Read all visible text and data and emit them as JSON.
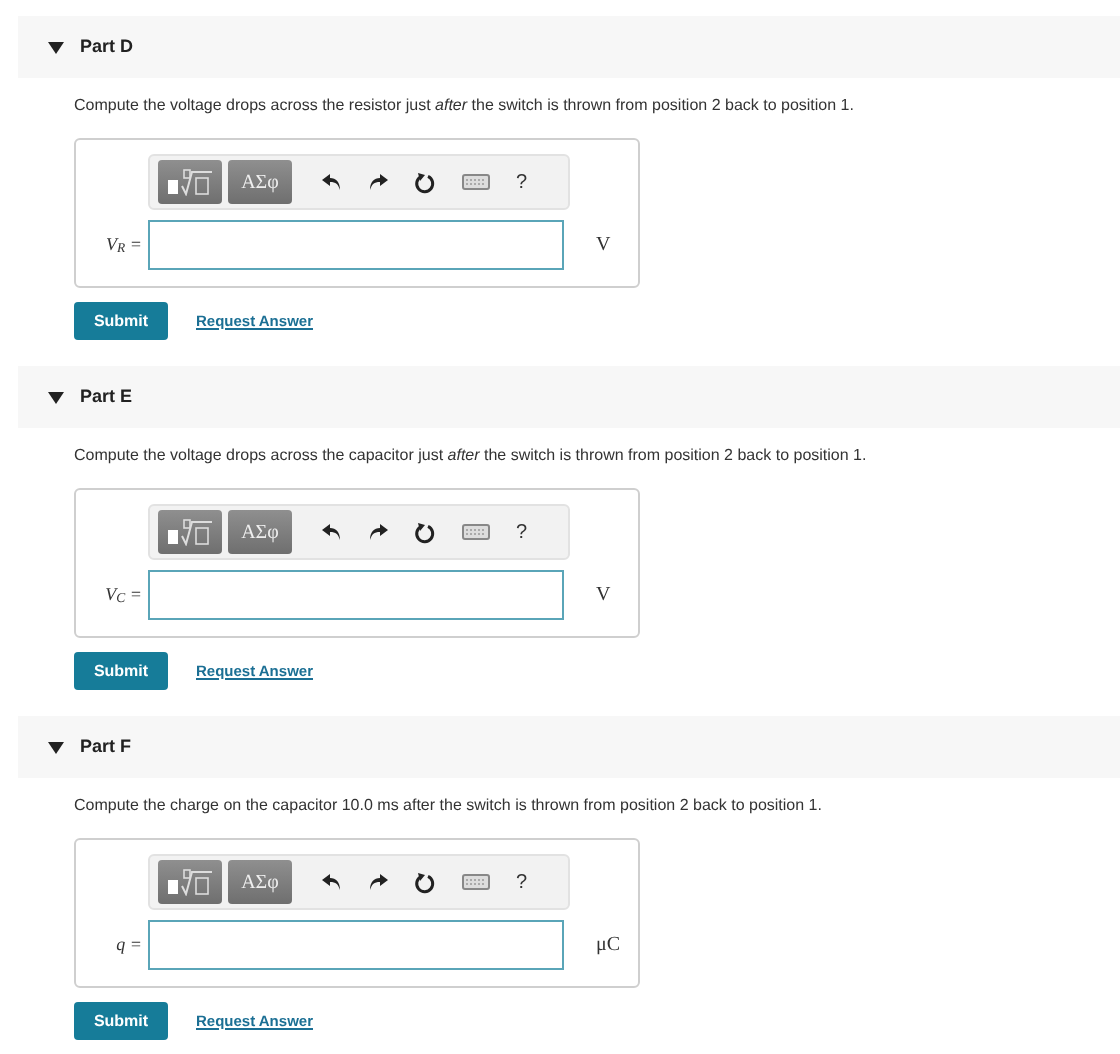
{
  "parts": [
    {
      "title": "Part D",
      "expanded": true,
      "prompt": "Compute the voltage drops across the resistor just *after* the switch is thrown from position 2 back to position 1.",
      "toolbar": {
        "symbols": "ΑΣφ",
        "help": "?"
      },
      "label": "V$_{R}$ =",
      "unit": "V",
      "submit": "Submit",
      "request": "Request Answer"
    },
    {
      "title": "Part E",
      "expanded": true,
      "prompt": "Compute the voltage drops across the capacitor just *after* the switch is thrown from position 2 back to position 1.",
      "toolbar": {
        "symbols": "ΑΣφ",
        "help": "?"
      },
      "label": "V$_{C}$ =",
      "unit": "V",
      "submit": "Submit",
      "request": "Request Answer"
    },
    {
      "title": "Part F",
      "expanded": true,
      "prompt": "Compute the charge on the capacitor 10.0 ms after the switch is thrown from position 2 back to position 1.",
      "toolbar": {
        "symbols": "ΑΣφ",
        "help": "?"
      },
      "label": "q =",
      "unit": "μC",
      "submit": "Submit",
      "request": "Request Answer"
    }
  ]
}
